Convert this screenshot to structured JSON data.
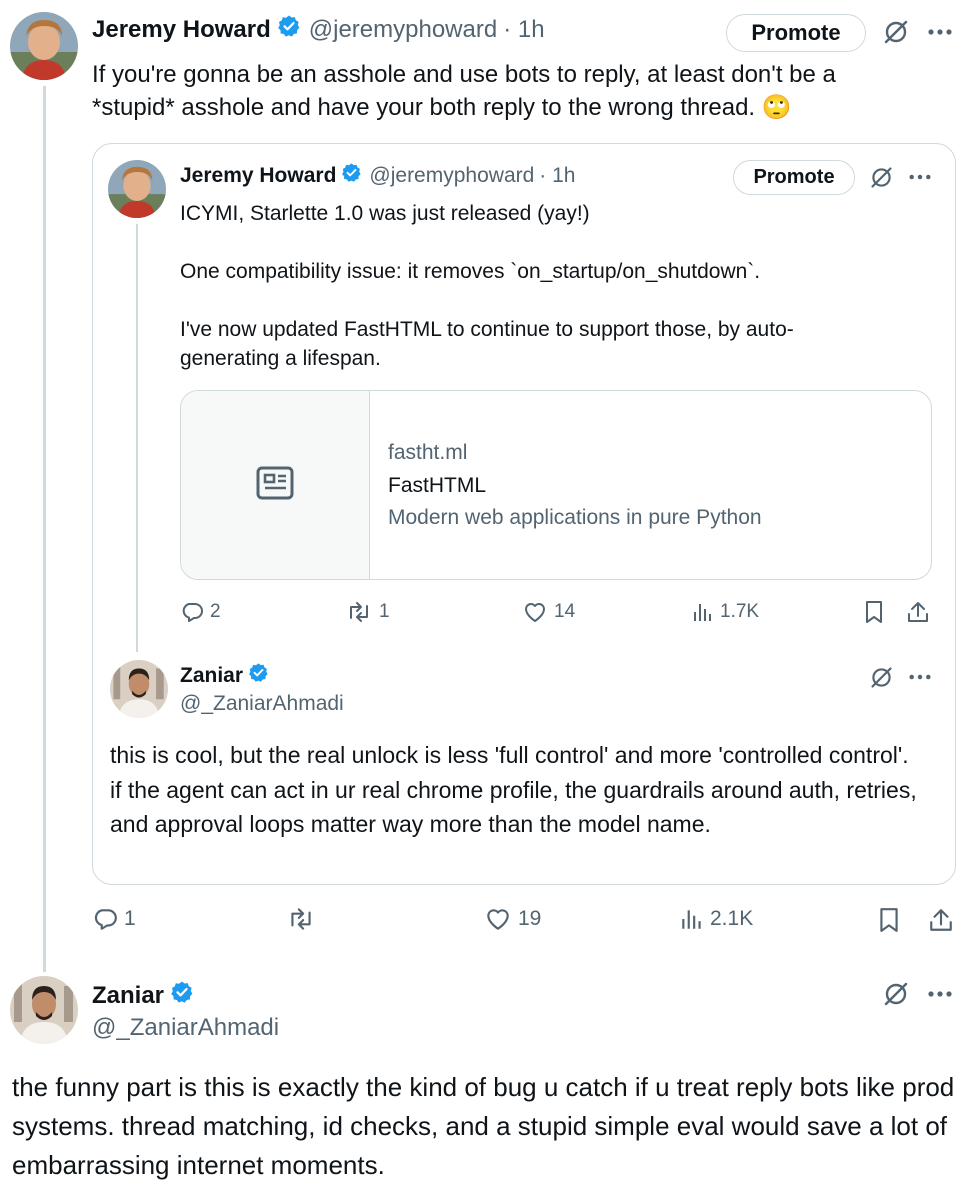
{
  "tweet1": {
    "author_name": "Jeremy Howard",
    "handle": "@jeremyphoward",
    "time": "· 1h",
    "promote_label": "Promote",
    "text": "If you're gonna be an asshole and use bots to reply, at least don't be a *stupid* asshole and have your both reply to the wrong thread. 🙄",
    "stats": {
      "replies": "1",
      "retweets": "",
      "likes": "19",
      "views": "2.1K"
    }
  },
  "quoted": {
    "author_name": "Jeremy Howard",
    "handle": "@jeremyphoward",
    "time": "· 1h",
    "promote_label": "Promote",
    "text_line1": "ICYMI, Starlette 1.0 was just released (yay!)",
    "text_line2": "One compatibility issue: it removes `on_startup/on_shutdown`.",
    "text_line3": "I've now updated FastHTML to continue to support those, by auto-generating a lifespan.",
    "card": {
      "domain": "fastht.ml",
      "title": "FastHTML",
      "description": "Modern web applications in pure Python"
    },
    "stats": {
      "replies": "2",
      "retweets": "1",
      "likes": "14",
      "views": "1.7K"
    }
  },
  "quoted_reply": {
    "author_name": "Zaniar",
    "handle": "@_ZaniarAhmadi",
    "text": "this is cool, but the real unlock is less 'full control' and more 'controlled control'. if the agent can act in ur real chrome profile, the guardrails around auth, retries, and approval loops matter way more than the model name."
  },
  "reply": {
    "author_name": "Zaniar",
    "handle": "@_ZaniarAhmadi",
    "text": "the funny part is this is exactly the kind of bug u catch if u treat reply bots like prod systems. thread matching, id checks, and a stupid simple eval would save a lot of embarrassing internet moments."
  },
  "colors": {
    "verified": "#1d9bf0",
    "text_primary": "#0f1419",
    "text_secondary": "#536471",
    "border": "#cfd9de"
  }
}
